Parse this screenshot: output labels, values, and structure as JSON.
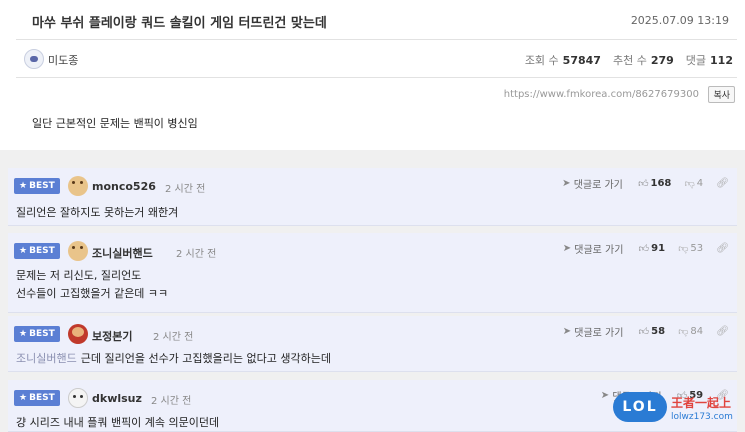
{
  "post": {
    "title": "마쑤 부쉬 플레이랑 쿼드 솔킬이 게임 터뜨린건 맞는데",
    "date": "2025.07.09 13:19",
    "author": "미도종",
    "stats": {
      "views_label": "조회 수",
      "views": "57847",
      "recommends_label": "추천 수",
      "recommends": "279",
      "comments_label": "댓글",
      "comments": "112"
    },
    "url": "https://www.fmkorea.com/8627679300",
    "copy_label": "복사",
    "body": "일단 근본적인 문제는 밴픽이 병신임"
  },
  "comment_common": {
    "best_label": "BEST",
    "reply_link": "댓글로 가기"
  },
  "comments": [
    {
      "user": "monco526",
      "time": "2 시간 전",
      "lines": [
        "질리언은 잘하지도 못하는거 왜한겨"
      ],
      "mention": "",
      "up": "168",
      "down": "4",
      "avatar": "dog-icon"
    },
    {
      "user": "조니실버핸드",
      "time": "2 시간 전",
      "lines": [
        "문제는 저 리신도, 질리언도",
        "선수들이 고집했을거 같은데 ㅋㅋ"
      ],
      "mention": "",
      "up": "91",
      "down": "53",
      "avatar": "dog-icon"
    },
    {
      "user": "보정본기",
      "time": "2 시간 전",
      "lines": [
        "근데 질리언을 선수가 고집했을리는 없다고 생각하는데"
      ],
      "mention": "조니실버핸드",
      "up": "58",
      "down": "84",
      "avatar": "character-icon"
    },
    {
      "user": "dkwlsuz",
      "time": "2 시간 전",
      "lines": [
        "걍 시리즈 내내 플쿼 밴픽이 계속 의문이던데"
      ],
      "mention": "",
      "up": "59",
      "down": "",
      "avatar": "white-dog-icon"
    }
  ],
  "watermark": {
    "badge": "LOL",
    "title": "王者一起上",
    "url": "lolwz173.com"
  },
  "colors": {
    "best_badge": "#5b7fd4",
    "comment_bg": "#eef0fb",
    "watermark_blue": "#2a7bd4",
    "watermark_red": "#e0443e"
  }
}
